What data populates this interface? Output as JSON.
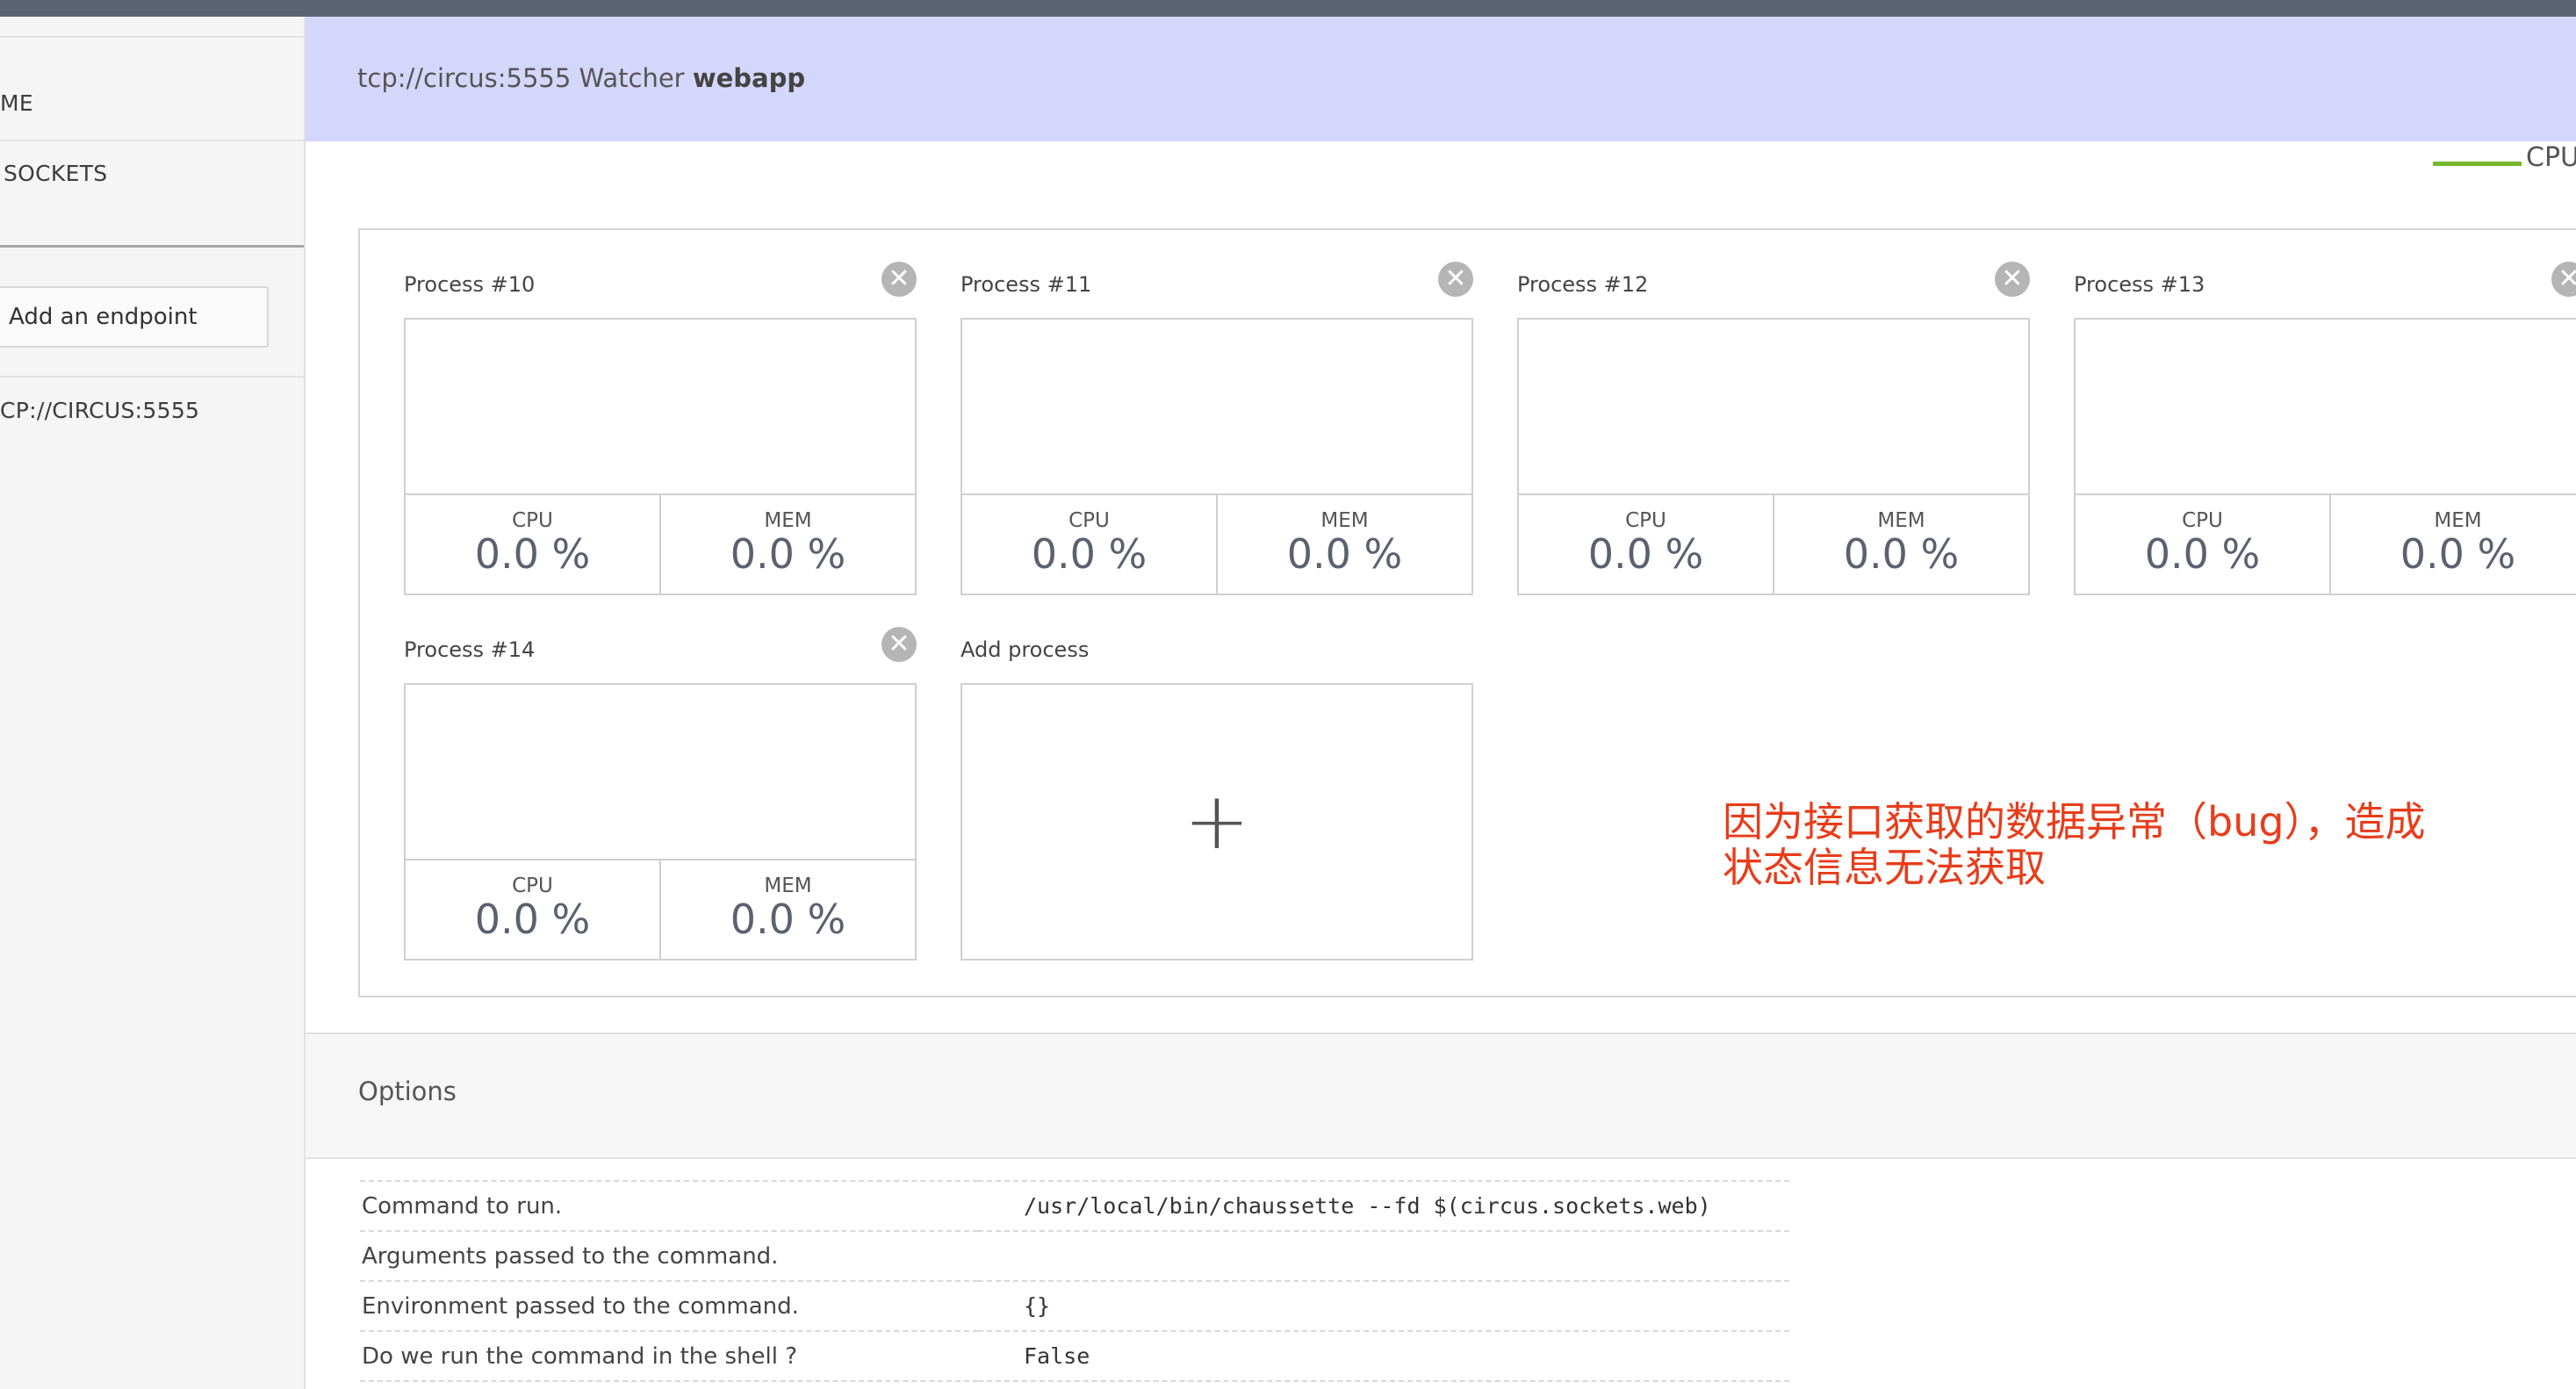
{
  "sidebar": {
    "nav_home": "ME",
    "nav_sockets": "SOCKETS",
    "add_endpoint": "Add an endpoint",
    "endpoint": "CP://CIRCUS:5555"
  },
  "header": {
    "prefix": "tcp://circus:5555 Watcher ",
    "watcher": "webapp"
  },
  "legend": {
    "label": "CPU",
    "color": "#76b82a"
  },
  "processes": [
    {
      "title": "Process #10",
      "cpu_label": "CPU",
      "cpu": "0.0 %",
      "mem_label": "MEM",
      "mem": "0.0 %"
    },
    {
      "title": "Process #11",
      "cpu_label": "CPU",
      "cpu": "0.0 %",
      "mem_label": "MEM",
      "mem": "0.0 %"
    },
    {
      "title": "Process #12",
      "cpu_label": "CPU",
      "cpu": "0.0 %",
      "mem_label": "MEM",
      "mem": "0.0 %"
    },
    {
      "title": "Process #13",
      "cpu_label": "CPU",
      "cpu": "0.0 %",
      "mem_label": "MEM",
      "mem": "0.0 %"
    },
    {
      "title": "Process #14",
      "cpu_label": "CPU",
      "cpu": "0.0 %",
      "mem_label": "MEM",
      "mem": "0.0 %"
    }
  ],
  "add_process": {
    "label": "Add process",
    "icon": "plus-icon",
    "symbol": "+"
  },
  "close_symbol": "✕",
  "annotation": {
    "line1": "因为接口获取的数据异常（bug），造成",
    "line2": "状态信息无法获取",
    "color": "#e83c1a"
  },
  "options": {
    "title": "Options",
    "rows": [
      {
        "label": "Command to run.",
        "value": "/usr/local/bin/chaussette --fd $(circus.sockets.web)"
      },
      {
        "label": "Arguments passed to the command.",
        "value": ""
      },
      {
        "label": "Environment passed to the command.",
        "value": "{}"
      },
      {
        "label": "Do we run the command in the shell ?",
        "value": "False"
      }
    ]
  }
}
